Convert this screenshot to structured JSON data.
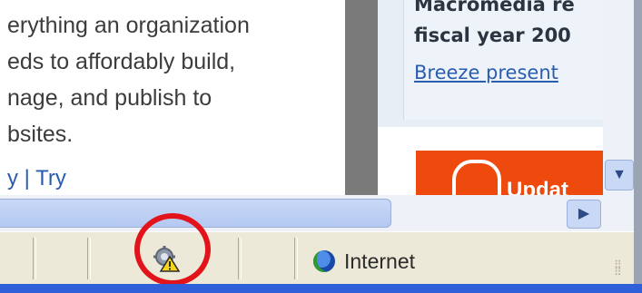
{
  "content": {
    "paragraph_lines": [
      "erything an organization",
      "eds to affordably build,",
      "nage, and publish to",
      "bsites."
    ],
    "links": {
      "left": "y",
      "separator": "|",
      "right": "Try"
    }
  },
  "sidebar": {
    "title_lines": [
      "Macromedia re",
      "fiscal year 200"
    ],
    "link": "Breeze present",
    "promo_text": "Updat"
  },
  "scrollbars": {
    "down_arrow": "▼",
    "right_arrow": "▶"
  },
  "statusbar": {
    "zone_label": "Internet",
    "warning_icon": "security-warning-gear-icon",
    "zone_icon": "globe-icon"
  },
  "colors": {
    "highlight": "#e3131b",
    "link": "#2a5db0",
    "promo": "#ef4a0e",
    "statusbar": "#ece9d8",
    "taskbar": "#2f5fd9"
  }
}
